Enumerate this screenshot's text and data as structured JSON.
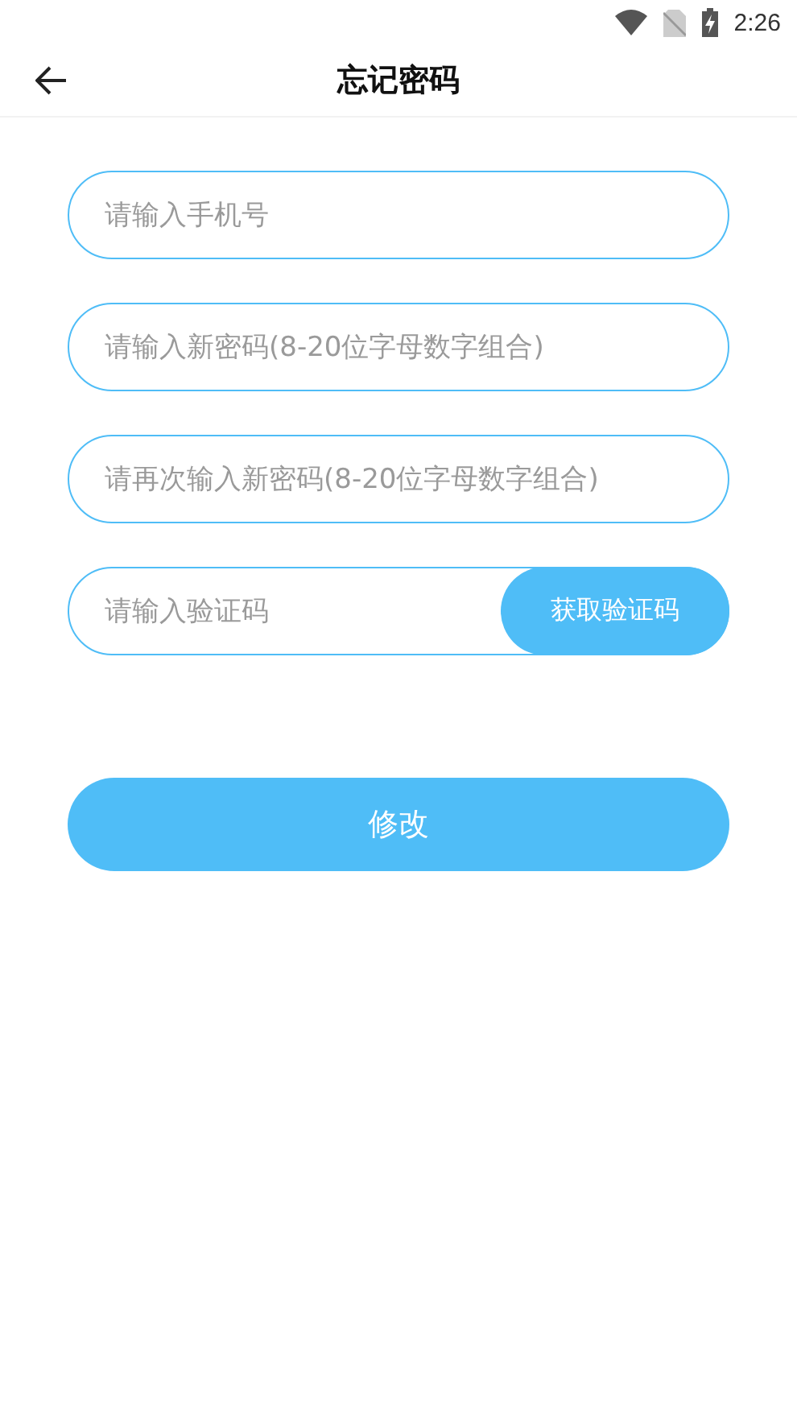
{
  "status_bar": {
    "time": "2:26"
  },
  "header": {
    "title": "忘记密码"
  },
  "fields": [
    {
      "placeholder": "请输入手机号"
    },
    {
      "placeholder": "请输入新密码(8-20位字母数字组合)"
    },
    {
      "placeholder": "请再次输入新密码(8-20位字母数字组合)"
    }
  ],
  "code_field": {
    "placeholder": "请输入验证码",
    "button": "获取验证码"
  },
  "submit": "修改"
}
